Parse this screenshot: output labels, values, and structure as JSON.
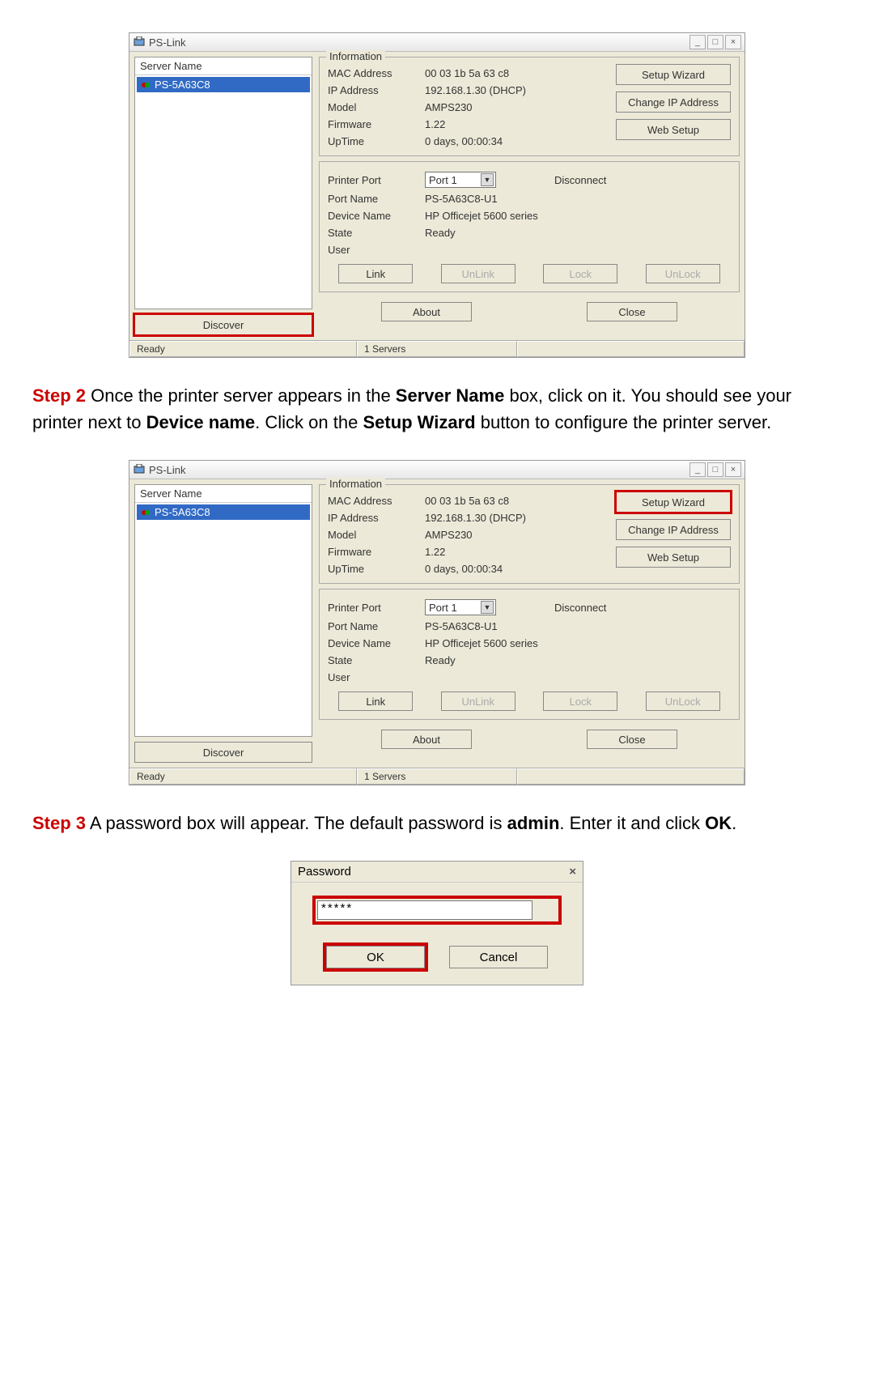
{
  "app": {
    "title": "PS-Link",
    "server_name_header": "Server Name",
    "server_item": "PS-5A63C8",
    "discover": "Discover",
    "info_title": "Information",
    "mac_label": "MAC Address",
    "mac_value": "00 03 1b 5a 63 c8",
    "ip_label": "IP Address",
    "ip_value": "192.168.1.30 (DHCP)",
    "model_label": "Model",
    "model_value": "AMPS230",
    "fw_label": "Firmware",
    "fw_value": "1.22",
    "uptime_label": "UpTime",
    "uptime_value": "0 days, 00:00:34",
    "setup_wizard": "Setup Wizard",
    "change_ip": "Change IP Address",
    "web_setup": "Web Setup",
    "port_label": "Printer Port",
    "port_value": "Port 1",
    "disconnect": "Disconnect",
    "portname_label": "Port Name",
    "portname_value": "PS-5A63C8-U1",
    "devname_label": "Device Name",
    "devname_value": "HP Officejet 5600 series",
    "state_label": "State",
    "state_value": "Ready",
    "user_label": "User",
    "link": "Link",
    "unlink": "UnLink",
    "lock": "Lock",
    "unlock": "UnLock",
    "about": "About",
    "close": "Close",
    "status_ready": "Ready",
    "status_servers": "1 Servers"
  },
  "step2": {
    "label": "Step 2",
    "text1": " Once the printer server appears in the ",
    "b1": "Server Name",
    "text2": " box, click on it. You should see your printer next to ",
    "b2": "Device name",
    "text3": ".  Click on the ",
    "b3": "Setup Wizard",
    "text4": " button to configure the printer server."
  },
  "step3": {
    "label": "Step 3",
    "text1": " A password box will appear.  The default password is ",
    "b1": "admin",
    "text2": ".  Enter it and click ",
    "b2": "OK",
    "text3": "."
  },
  "password": {
    "title": "Password",
    "value": "*****",
    "ok": "OK",
    "cancel": "Cancel"
  }
}
